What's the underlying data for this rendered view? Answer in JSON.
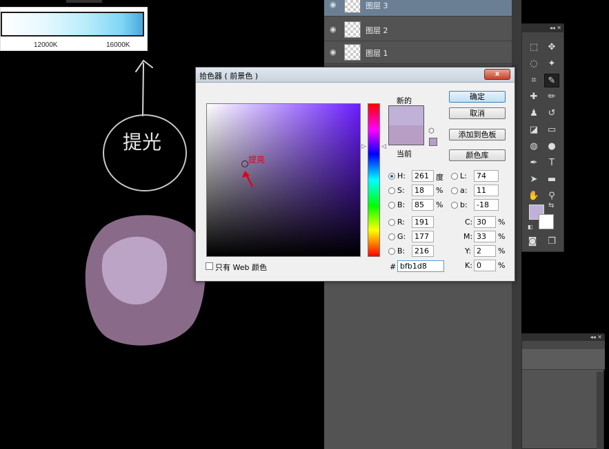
{
  "canvas": {
    "kelvin_labels": [
      "12000K",
      "16000K"
    ],
    "handwriting": "提光"
  },
  "layers": [
    {
      "name": "图层 3",
      "selected": true
    },
    {
      "name": "图层 2",
      "selected": false
    },
    {
      "name": "图层 1",
      "selected": false
    }
  ],
  "tools": {
    "foreground_color": "#bfb1d8",
    "background_color": "#ffffff"
  },
  "dialog": {
    "title": "拾色器 ( 前景色 )",
    "close_glyph": "x",
    "new_label": "新的",
    "current_label": "当前",
    "new_color": "#bfb1d8",
    "current_color": "#b89ec4",
    "buttons": {
      "ok": "确定",
      "cancel": "取消",
      "add_to_swatches": "添加到色板",
      "color_libraries": "颜色库"
    },
    "hsb": {
      "h_label": "H:",
      "h": "261",
      "h_unit": "度",
      "s_label": "S:",
      "s": "18",
      "s_unit": "%",
      "b_label": "B:",
      "b": "85",
      "b_unit": "%"
    },
    "rgb": {
      "r_label": "R:",
      "r": "191",
      "g_label": "G:",
      "g": "177",
      "b_label": "B:",
      "b": "216"
    },
    "lab": {
      "l_label": "L:",
      "l": "74",
      "a_label": "a:",
      "a": "11",
      "b_label": "b:",
      "b": "-18"
    },
    "cmyk": {
      "c_label": "C:",
      "c": "30",
      "m_label": "M:",
      "m": "33",
      "y_label": "Y:",
      "y": "2",
      "k_label": "K:",
      "k": "0",
      "unit": "%"
    },
    "web_only_label": "只有 Web 颜色",
    "hex_label": "#",
    "hex": "bfb1d8",
    "annotation": "提亮"
  }
}
